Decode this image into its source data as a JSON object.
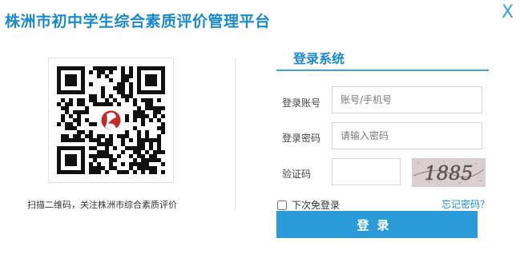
{
  "header": {
    "title": "株洲市初中学生综合素质评价管理平台",
    "close_icon_text": "X"
  },
  "qr": {
    "caption": "扫描二维码，关注株洲市综合素质评价"
  },
  "login": {
    "title": "登录系统",
    "account_label": "登录账号",
    "account_placeholder": "账号/手机号",
    "password_label": "登录密码",
    "password_placeholder": "请输入密码",
    "captcha_label": "验证码",
    "captcha_text": "1885",
    "remember_label": "下次免登录",
    "forgot_link": "忘记密码？",
    "submit_label": "登录"
  },
  "colors": {
    "accent": "#1a8ad0",
    "button": "#2a9ad8"
  }
}
